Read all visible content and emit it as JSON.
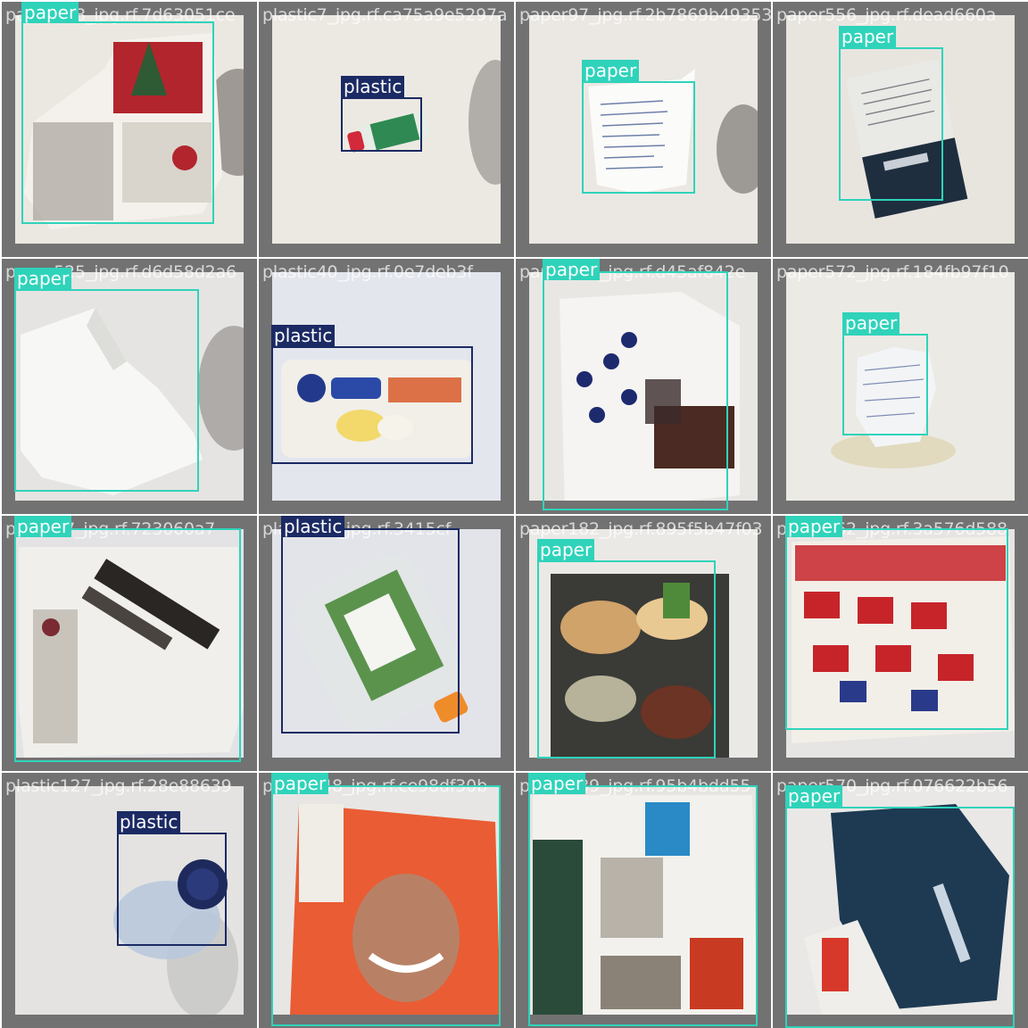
{
  "colors": {
    "paper": "#2fd3ba",
    "plastic": "#1b2a63",
    "tile_bg": "#727272"
  },
  "tiles": [
    {
      "filename": "paper518_jpg.rf.7d63051ce",
      "photo_bg": "#e9e5df",
      "scene": "catalog",
      "detections": [
        {
          "label": "paper"
        }
      ]
    },
    {
      "filename": "plastic7_jpg.rf.ca75a9e5297a",
      "photo_bg": "#ece9e3",
      "scene": "small-bottle",
      "detections": [
        {
          "label": "plastic"
        }
      ]
    },
    {
      "filename": "paper97_jpg.rf.2b7869b49353",
      "photo_bg": "#ebe8e3",
      "scene": "receipt",
      "detections": [
        {
          "label": "paper"
        }
      ]
    },
    {
      "filename": "paper556_jpg.rf.dead660a",
      "photo_bg": "#e8e5df",
      "scene": "box",
      "detections": [
        {
          "label": "paper"
        }
      ]
    },
    {
      "filename": "paper525_jpg.rf.d6d58d2a6",
      "photo_bg": "#e6e4e2",
      "scene": "envelope",
      "detections": [
        {
          "label": "paper"
        }
      ]
    },
    {
      "filename": "plastic40_jpg.rf.0e7deb3f",
      "photo_bg": "#e4e6ee",
      "scene": "egg-carton",
      "detections": [
        {
          "label": "plastic"
        }
      ]
    },
    {
      "filename": "paper380_jpg.rf.d45af842e",
      "photo_bg": "#e9e7e4",
      "scene": "magazine",
      "detections": [
        {
          "label": "paper"
        }
      ]
    },
    {
      "filename": "paper572_jpg.rf.184fb97f10",
      "photo_bg": "#eceae4",
      "scene": "crumpled",
      "detections": [
        {
          "label": "paper"
        }
      ]
    },
    {
      "filename": "paper37_jpg.rf.723060a7",
      "photo_bg": "#e3e3e6",
      "scene": "newspaper",
      "detections": [
        {
          "label": "paper"
        }
      ]
    },
    {
      "filename": "plastic20_jpg.rf.3415cf",
      "photo_bg": "#e3e4ea",
      "scene": "jug",
      "detections": [
        {
          "label": "plastic"
        }
      ]
    },
    {
      "filename": "paper182_jpg.rf.895f5b47f03",
      "photo_bg": "#ebe9e6",
      "scene": "food-mag",
      "detections": [
        {
          "label": "paper"
        }
      ]
    },
    {
      "filename": "paper562_jpg.rf.3a576d588",
      "photo_bg": "#e7e5e3",
      "scene": "flyer",
      "detections": [
        {
          "label": "paper"
        }
      ]
    },
    {
      "filename": "plastic127_jpg.rf.28e88639",
      "photo_bg": "#e4e3e1",
      "scene": "bottle",
      "detections": [
        {
          "label": "plastic"
        }
      ]
    },
    {
      "filename": "paper248_jpg.rf.ce98df30b",
      "photo_bg": "#e7e6e4",
      "scene": "face-mag",
      "detections": [
        {
          "label": "paper"
        }
      ]
    },
    {
      "filename": "paper389_jpg.rf.95b4bdd55",
      "photo_bg": "#e6e5e1",
      "scene": "orchard",
      "detections": [
        {
          "label": "paper"
        }
      ]
    },
    {
      "filename": "paper570_jpg.rf.076622b56",
      "photo_bg": "#e9e8e6",
      "scene": "blue-ad",
      "detections": [
        {
          "label": "paper"
        }
      ]
    }
  ]
}
